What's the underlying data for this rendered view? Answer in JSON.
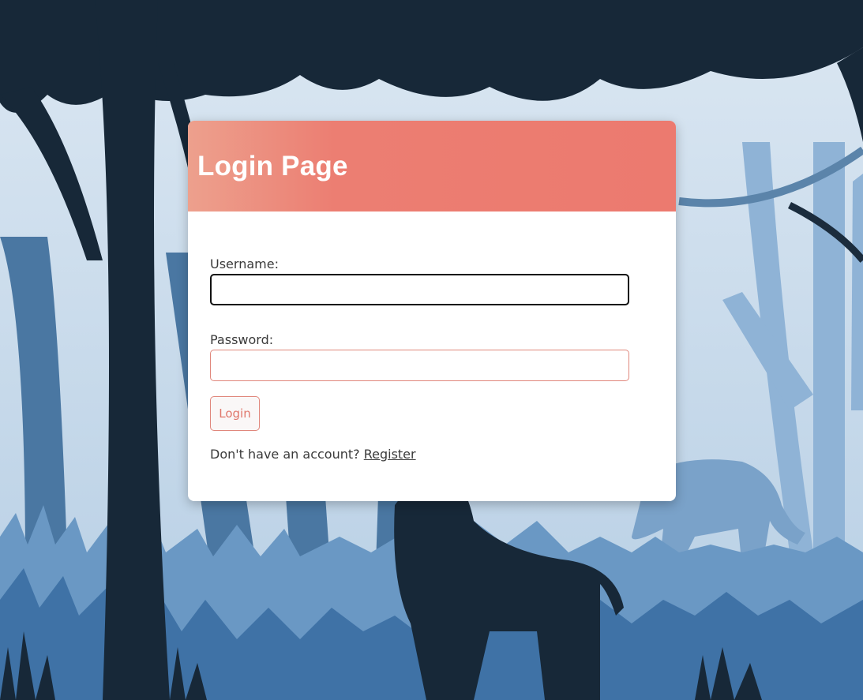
{
  "login": {
    "title": "Login Page",
    "username_label": "Username:",
    "username_value": "",
    "password_label": "Password:",
    "password_value": "",
    "login_button": "Login",
    "register_prompt": "Don't have an account?",
    "register_link": "Register"
  },
  "colors": {
    "header_accent": "#ec7a6f",
    "input_border": "#e0877c",
    "background_dark": "#172838",
    "background_light": "#c7daeb"
  }
}
